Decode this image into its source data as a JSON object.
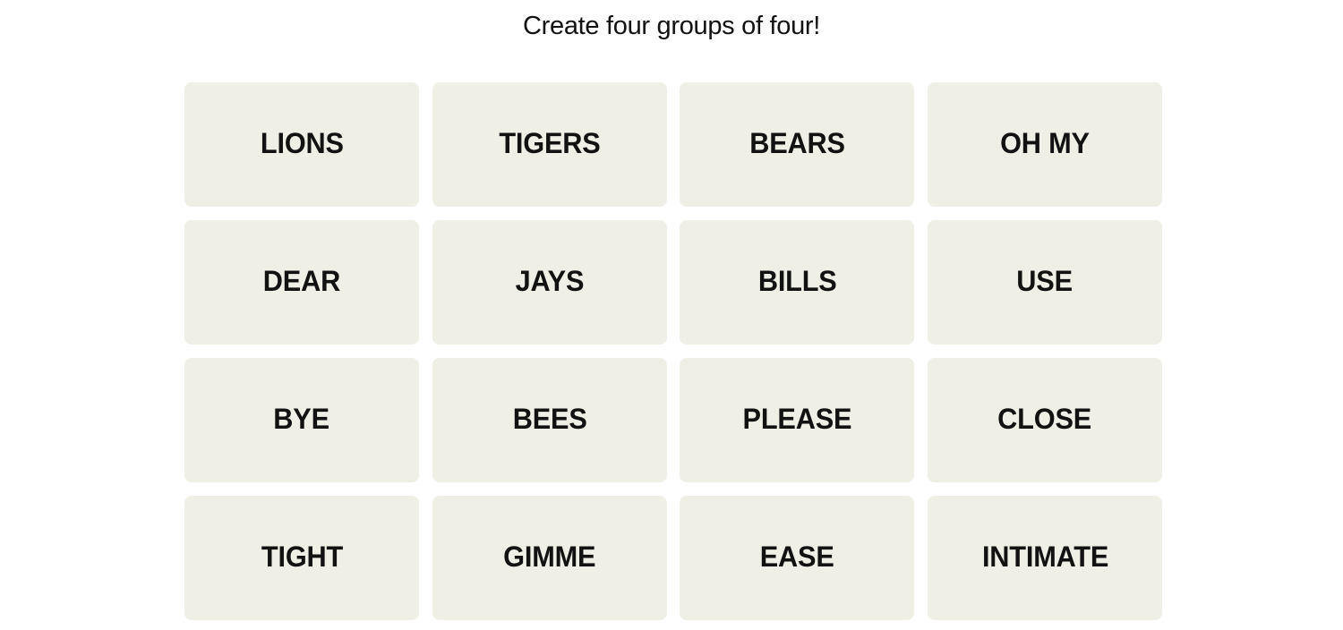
{
  "instructions": "Create four groups of four!",
  "colors": {
    "tile_background": "#efefe6",
    "tile_text": "#121212",
    "page_background": "#ffffff"
  },
  "tiles": [
    {
      "label": "LIONS"
    },
    {
      "label": "TIGERS"
    },
    {
      "label": "BEARS"
    },
    {
      "label": "OH MY"
    },
    {
      "label": "DEAR"
    },
    {
      "label": "JAYS"
    },
    {
      "label": "BILLS"
    },
    {
      "label": "USE"
    },
    {
      "label": "BYE"
    },
    {
      "label": "BEES"
    },
    {
      "label": "PLEASE"
    },
    {
      "label": "CLOSE"
    },
    {
      "label": "TIGHT"
    },
    {
      "label": "GIMME"
    },
    {
      "label": "EASE"
    },
    {
      "label": "INTIMATE"
    }
  ]
}
